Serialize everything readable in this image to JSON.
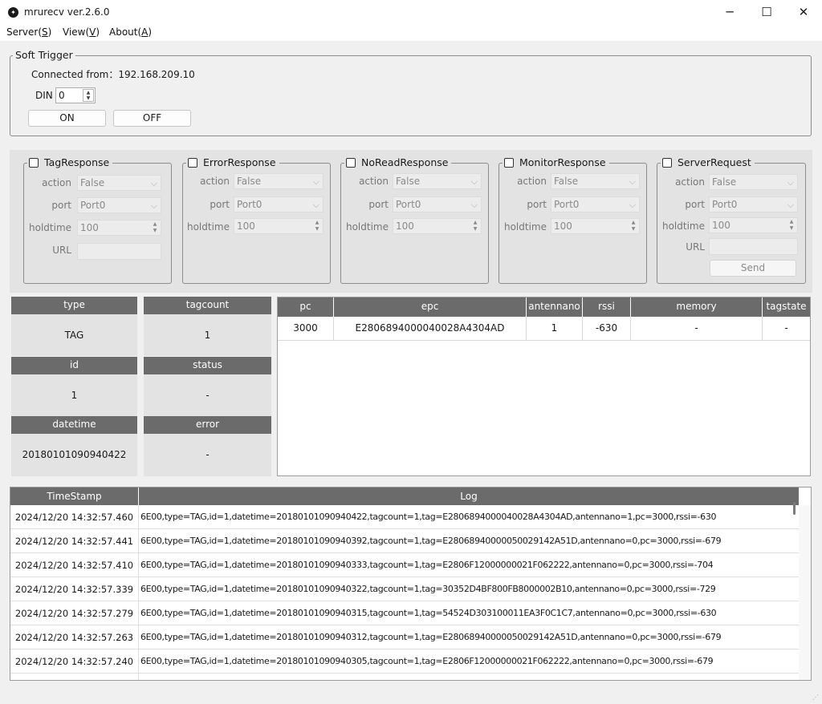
{
  "window": {
    "title": "mrurecv ver.2.6.0",
    "minimize": "─",
    "maximize": "☐",
    "close": "✕"
  },
  "menu": [
    {
      "label": "Server(",
      "key": "S",
      "suffix": ")"
    },
    {
      "label": "View(",
      "key": "V",
      "suffix": ")"
    },
    {
      "label": "About(",
      "key": "A",
      "suffix": ")"
    }
  ],
  "soft_trigger": {
    "legend": "Soft Trigger",
    "connected_from": "Connected from：192.168.209.10",
    "din_label": "DIN",
    "din_value": "0",
    "on_label": "ON",
    "off_label": "OFF"
  },
  "panels": [
    {
      "title": "TagResponse",
      "action_label": "action",
      "action_value": "False",
      "port_label": "port",
      "port_value": "Port0",
      "holdtime_label": "holdtime",
      "holdtime_value": "100",
      "url_label": "URL"
    },
    {
      "title": "ErrorResponse",
      "action_label": "action",
      "action_value": "False",
      "port_label": "port",
      "port_value": "Port0",
      "holdtime_label": "holdtime",
      "holdtime_value": "100"
    },
    {
      "title": "NoReadResponse",
      "action_label": "action",
      "action_value": "False",
      "port_label": "port",
      "port_value": "Port0",
      "holdtime_label": "holdtime",
      "holdtime_value": "100"
    },
    {
      "title": "MonitorResponse",
      "action_label": "action",
      "action_value": "False",
      "port_label": "port",
      "port_value": "Port0",
      "holdtime_label": "holdtime",
      "holdtime_value": "100"
    },
    {
      "title": "ServerRequest",
      "action_label": "action",
      "action_value": "False",
      "port_label": "port",
      "port_value": "Port0",
      "holdtime_label": "holdtime",
      "holdtime_value": "100",
      "url_label": "URL",
      "send_label": "Send"
    }
  ],
  "info": {
    "type_label": "type",
    "type_value": "TAG",
    "tagcount_label": "tagcount",
    "tagcount_value": "1",
    "id_label": "id",
    "id_value": "1",
    "status_label": "status",
    "status_value": "-",
    "datetime_label": "datetime",
    "datetime_value": "20180101090940422",
    "error_label": "error",
    "error_value": "-"
  },
  "tag_grid": {
    "columns": [
      "pc",
      "epc",
      "antennano",
      "rssi",
      "memory",
      "tagstate"
    ],
    "rows": [
      [
        "3000",
        "E2806894000040028A4304AD",
        "1",
        "-630",
        "-",
        "-"
      ]
    ]
  },
  "log": {
    "columns": [
      "TimeStamp",
      "Log"
    ],
    "rows": [
      {
        "ts": "2024/12/20 14:32:57.460",
        "msg": "6E00,type=TAG,id=1,datetime=20180101090940422,tagcount=1,tag=E2806894000040028A4304AD,antennano=1,pc=3000,rssi=-630"
      },
      {
        "ts": "2024/12/20 14:32:57.441",
        "msg": "6E00,type=TAG,id=1,datetime=20180101090940392,tagcount=1,tag=E28068940000050029142A51D,antennano=0,pc=3000,rssi=-679"
      },
      {
        "ts": "2024/12/20 14:32:57.410",
        "msg": "6E00,type=TAG,id=1,datetime=20180101090940333,tagcount=1,tag=E2806F12000000021F062222,antennano=0,pc=3000,rssi=-704"
      },
      {
        "ts": "2024/12/20 14:32:57.339",
        "msg": "6E00,type=TAG,id=1,datetime=20180101090940322,tagcount=1,tag=30352D4BF800FB8000002B10,antennano=0,pc=3000,rssi=-729"
      },
      {
        "ts": "2024/12/20 14:32:57.279",
        "msg": "6E00,type=TAG,id=1,datetime=20180101090940315,tagcount=1,tag=54524D303100011EA3F0C1C7,antennano=0,pc=3000,rssi=-630"
      },
      {
        "ts": "2024/12/20 14:32:57.263",
        "msg": "6E00,type=TAG,id=1,datetime=20180101090940312,tagcount=1,tag=E28068940000050029142A51D,antennano=0,pc=3000,rssi=-679"
      },
      {
        "ts": "2024/12/20 14:32:57.240",
        "msg": "6E00,type=TAG,id=1,datetime=20180101090940305,tagcount=1,tag=E2806F12000000021F062222,antennano=0,pc=3000,rssi=-679"
      }
    ]
  }
}
